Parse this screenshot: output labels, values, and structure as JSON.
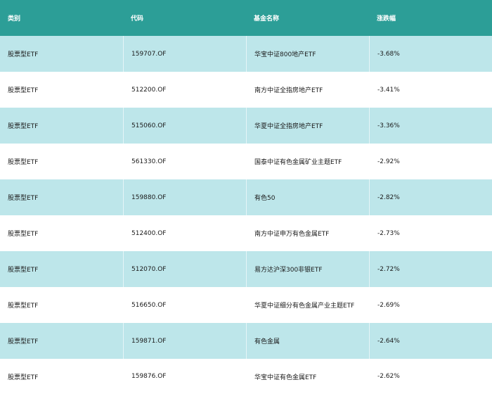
{
  "table": {
    "headers": [
      "类别",
      "代码",
      "基金名称",
      "涨跌幅"
    ],
    "rows": [
      [
        "股票型ETF",
        "159707.OF",
        "华宝中证800地产ETF",
        "-3.68%"
      ],
      [
        "股票型ETF",
        "512200.OF",
        "南方中证全指房地产ETF",
        "-3.41%"
      ],
      [
        "股票型ETF",
        "515060.OF",
        "华夏中证全指房地产ETF",
        "-3.36%"
      ],
      [
        "股票型ETF",
        "561330.OF",
        "国泰中证有色金属矿业主题ETF",
        "-2.92%"
      ],
      [
        "股票型ETF",
        "159880.OF",
        "有色50",
        "-2.82%"
      ],
      [
        "股票型ETF",
        "512400.OF",
        "南方中证申万有色金属ETF",
        "-2.73%"
      ],
      [
        "股票型ETF",
        "512070.OF",
        "易方达沪深300非银ETF",
        "-2.72%"
      ],
      [
        "股票型ETF",
        "516650.OF",
        "华夏中证细分有色金属产业主题ETF",
        "-2.69%"
      ],
      [
        "股票型ETF",
        "159871.OF",
        "有色金属",
        "-2.64%"
      ],
      [
        "股票型ETF",
        "159876.OF",
        "华宝中证有色金属ETF",
        "-2.62%"
      ]
    ]
  },
  "colors": {
    "header_bg": "#2c9e97",
    "row_alt_bg": "#bde6ea",
    "row_bg": "#ffffff"
  }
}
